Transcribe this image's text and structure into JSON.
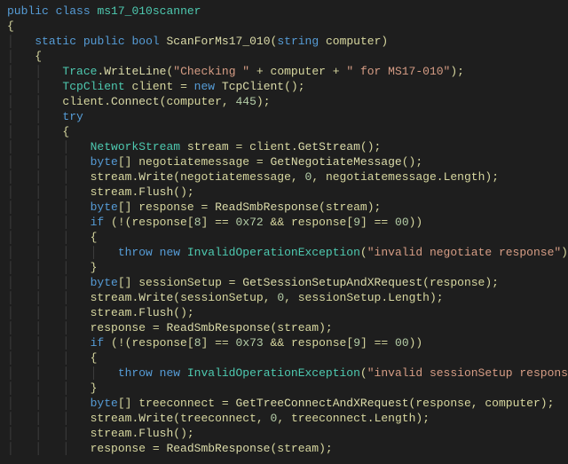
{
  "code": {
    "l1": {
      "kw1": "public",
      "kw2": "class",
      "cls": "ms17_010scanner"
    },
    "l2": {
      "brace": "{"
    },
    "l3": {
      "kw1": "static",
      "kw2": "public",
      "kw3": "bool",
      "mname": "ScanForMs17_010",
      "p1": "(",
      "kw4": "string",
      "param": "computer",
      "p2": ")"
    },
    "l4": {
      "brace": "{"
    },
    "l5": {
      "cls": "Trace",
      "dot": ".",
      "m": "WriteLine",
      "p1": "(",
      "s1": "\"Checking \"",
      "op1": " + ",
      "id": "computer",
      "op2": " + ",
      "s2": "\" for MS17-010\"",
      "p2": ");"
    },
    "l6": {
      "cls": "TcpClient",
      "id": "client",
      "op": " = ",
      "kw": "new",
      "ctor": "TcpClient",
      "p": "();"
    },
    "l7": {
      "id": "client",
      "dot": ".",
      "m": "Connect",
      "p1": "(",
      "arg1": "computer",
      "c": ", ",
      "n": "445",
      "p2": ");"
    },
    "l8": {
      "kw": "try"
    },
    "l9": {
      "brace": "{"
    },
    "l10": {
      "cls": "NetworkStream",
      "id": "stream",
      "op": " = ",
      "obj": "client",
      "dot": ".",
      "m": "GetStream",
      "p": "();"
    },
    "l11": {
      "kw": "byte",
      "arr": "[] ",
      "id": "negotiatemessage",
      "op": " = ",
      "m": "GetNegotiateMessage",
      "p": "();"
    },
    "l12": {
      "obj": "stream",
      "dot": ".",
      "m": "Write",
      "p1": "(",
      "a1": "negotiatemessage",
      "c1": ", ",
      "n1": "0",
      "c2": ", ",
      "a2": "negotiatemessage",
      "dot2": ".",
      "prop": "Length",
      "p2": ");"
    },
    "l13": {
      "obj": "stream",
      "dot": ".",
      "m": "Flush",
      "p": "();"
    },
    "l14": {
      "kw": "byte",
      "arr": "[] ",
      "id": "response",
      "op": " = ",
      "m": "ReadSmbResponse",
      "p1": "(",
      "a": "stream",
      "p2": ");"
    },
    "l15": {
      "kw": "if",
      "p1": " (!(",
      "id1": "response",
      "idx1": "[",
      "n1": "8",
      "idx1b": "] == ",
      "hex": "0x72",
      "op": " && ",
      "id2": "response",
      "idx2": "[",
      "n2": "9",
      "idx2b": "] == ",
      "n3": "00",
      "p2": "))"
    },
    "l16": {
      "brace": "{"
    },
    "l17": {
      "kw": "throw",
      "sp": " ",
      "kw2": "new",
      "sp2": " ",
      "cls": "InvalidOperationException",
      "p1": "(",
      "s": "\"invalid negotiate response\"",
      "p2": ");"
    },
    "l18": {
      "brace": "}"
    },
    "l19": {
      "kw": "byte",
      "arr": "[] ",
      "id": "sessionSetup",
      "op": " = ",
      "m": "GetSessionSetupAndXRequest",
      "p1": "(",
      "a": "response",
      "p2": ");"
    },
    "l20": {
      "obj": "stream",
      "dot": ".",
      "m": "Write",
      "p1": "(",
      "a1": "sessionSetup",
      "c1": ", ",
      "n1": "0",
      "c2": ", ",
      "a2": "sessionSetup",
      "dot2": ".",
      "prop": "Length",
      "p2": ");"
    },
    "l21": {
      "obj": "stream",
      "dot": ".",
      "m": "Flush",
      "p": "();"
    },
    "l22": {
      "id": "response",
      "op": " = ",
      "m": "ReadSmbResponse",
      "p1": "(",
      "a": "stream",
      "p2": ");"
    },
    "l23": {
      "kw": "if",
      "p1": " (!(",
      "id1": "response",
      "idx1": "[",
      "n1": "8",
      "idx1b": "] == ",
      "hex": "0x73",
      "op": " && ",
      "id2": "response",
      "idx2": "[",
      "n2": "9",
      "idx2b": "] == ",
      "n3": "00",
      "p2": "))"
    },
    "l24": {
      "brace": "{"
    },
    "l25": {
      "kw": "throw",
      "sp": " ",
      "kw2": "new",
      "sp2": " ",
      "cls": "InvalidOperationException",
      "p1": "(",
      "s": "\"invalid sessionSetup response\"",
      "p2": ");"
    },
    "l26": {
      "brace": "}"
    },
    "l27": {
      "kw": "byte",
      "arr": "[] ",
      "id": "treeconnect",
      "op": " = ",
      "m": "GetTreeConnectAndXRequest",
      "p1": "(",
      "a1": "response",
      "c": ", ",
      "a2": "computer",
      "p2": ");"
    },
    "l28": {
      "obj": "stream",
      "dot": ".",
      "m": "Write",
      "p1": "(",
      "a1": "treeconnect",
      "c1": ", ",
      "n1": "0",
      "c2": ", ",
      "a2": "treeconnect",
      "dot2": ".",
      "prop": "Length",
      "p2": ");"
    },
    "l29": {
      "obj": "stream",
      "dot": ".",
      "m": "Flush",
      "p": "();"
    },
    "l30": {
      "id": "response",
      "op": " = ",
      "m": "ReadSmbResponse",
      "p1": "(",
      "a": "stream",
      "p2": ");"
    }
  }
}
